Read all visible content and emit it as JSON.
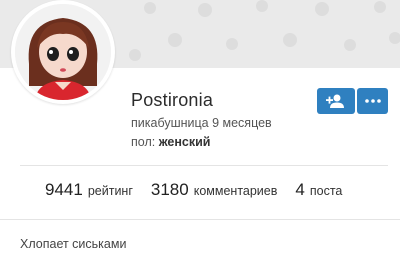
{
  "profile": {
    "username": "Postironia",
    "tenure": "пикабушница 9 месяцев",
    "gender_label": "пол:",
    "gender_value": "женский",
    "about": "Хлопает сиськами"
  },
  "actions": {
    "subscribe_icon": "add-user-icon",
    "more_icon": "more-dots-icon"
  },
  "stats": [
    {
      "value": "9441",
      "label": "рейтинг"
    },
    {
      "value": "3180",
      "label": "комментариев"
    },
    {
      "value": "4",
      "label": "поста"
    }
  ],
  "colors": {
    "accent": "#2f80c0",
    "cover": "#eaeaea",
    "divider": "#e4e4e4"
  }
}
